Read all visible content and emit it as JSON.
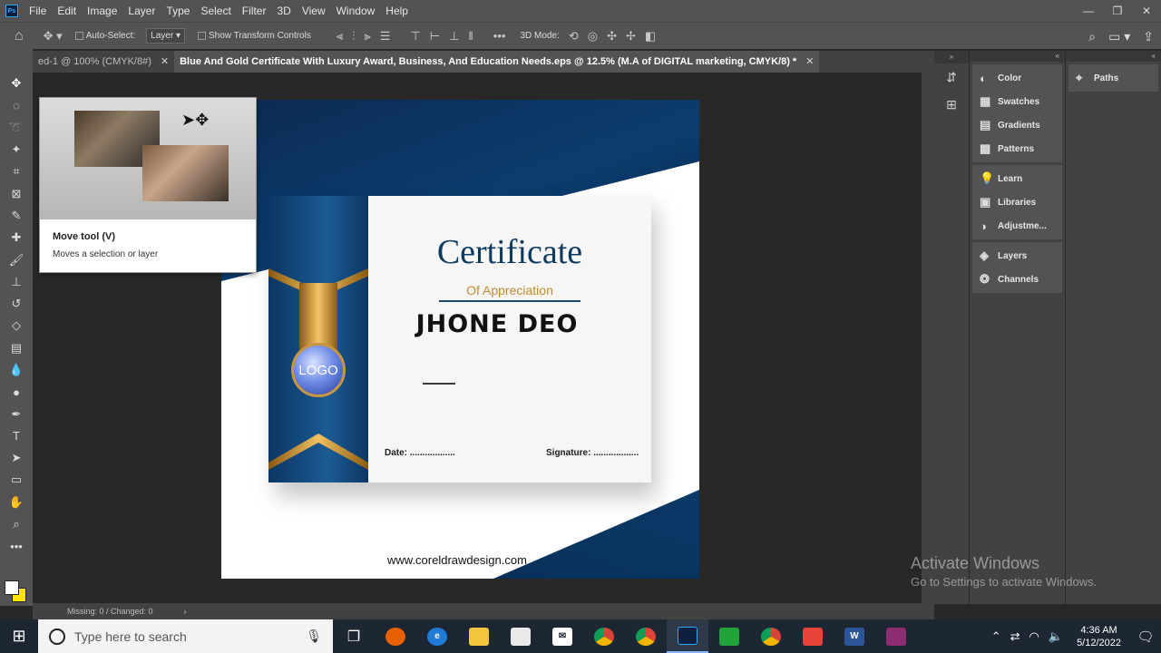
{
  "app": {
    "logo": "Ps"
  },
  "menu": [
    "File",
    "Edit",
    "Image",
    "Layer",
    "Type",
    "Select",
    "Filter",
    "3D",
    "View",
    "Window",
    "Help"
  ],
  "window_controls": {
    "minimize": "—",
    "restore": "❐",
    "close": "✕"
  },
  "options": {
    "auto_select_label": "Auto-Select:",
    "auto_select_target": "Layer",
    "transform_label": "Show Transform Controls",
    "mode_label": "3D Mode:",
    "more": "•••"
  },
  "tabs": [
    {
      "label": "ed-1 @ 100% (CMYK/8#)",
      "close": "✕"
    },
    {
      "label": "Blue And Gold Certificate With Luxury Award, Business, And Education Needs.eps @ 12.5% (M.A of DIGITAL marketing, CMYK/8) *",
      "close": "✕"
    }
  ],
  "tooltip": {
    "title": "Move tool (V)",
    "description": "Moves a selection or layer"
  },
  "certificate": {
    "title": "Certificate",
    "subtitle": "Of Appreciation",
    "name": "JHONE DEO",
    "logo": "LOGO",
    "date_label": "Date: ..................",
    "signature_label": "Signature: ..................",
    "website": "www.coreldrawdesign.com"
  },
  "panels": {
    "group1": [
      "Color",
      "Swatches",
      "Gradients",
      "Patterns"
    ],
    "group2": [
      "Learn",
      "Libraries",
      "Adjustme..."
    ],
    "group3": [
      "Layers",
      "Channels"
    ],
    "paths": "Paths"
  },
  "status": {
    "text": "Missing: 0 / Changed: 0",
    "arrow": "›"
  },
  "watermark": {
    "line1": "Activate Windows",
    "line2": "Go to Settings to activate Windows."
  },
  "taskbar": {
    "search_placeholder": "Type here to search",
    "time": "4:36 AM",
    "date": "5/12/2022"
  },
  "colors": {
    "foreground": "#ffffff",
    "background": "#ffe400",
    "accent": "#31a8ff"
  }
}
